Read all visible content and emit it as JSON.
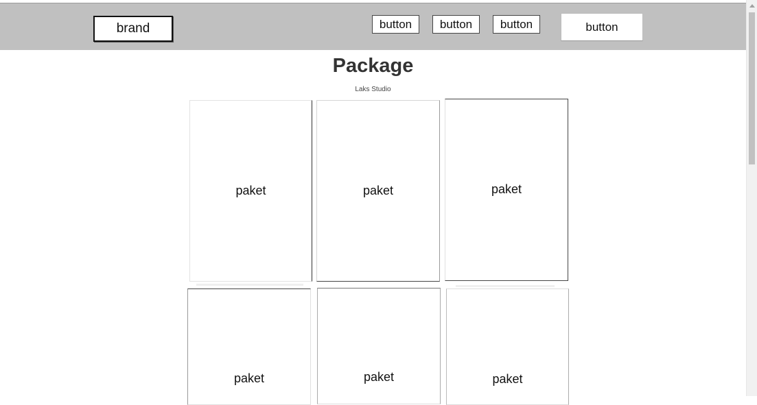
{
  "navbar": {
    "brand_label": "brand",
    "buttons": [
      "button",
      "button",
      "button",
      "button"
    ]
  },
  "header": {
    "title": "Package",
    "subtitle": "Laks Studio"
  },
  "packages": [
    {
      "label": "paket"
    },
    {
      "label": "paket"
    },
    {
      "label": "paket"
    },
    {
      "label": "paket"
    },
    {
      "label": "paket"
    },
    {
      "label": "paket"
    }
  ],
  "colors": {
    "navbar_bg": "#c0c0c0",
    "page_bg": "#ffffff",
    "title_text": "#333333"
  }
}
